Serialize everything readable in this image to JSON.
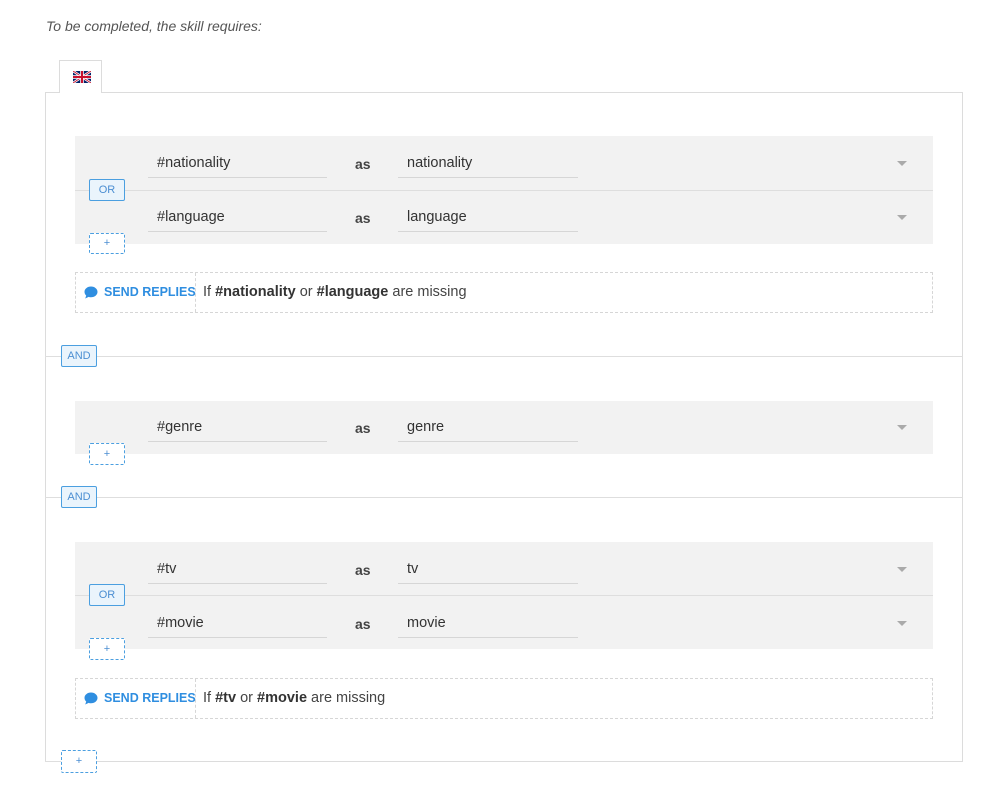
{
  "intro": "To be completed, the skill requires:",
  "language_tab": {
    "flag": "uk-flag-icon"
  },
  "operators": {
    "or": "OR",
    "and": "AND",
    "add": "+",
    "as": "as"
  },
  "groups": [
    {
      "rows": [
        {
          "entity": "#nationality",
          "as": "as",
          "variable": "nationality"
        },
        {
          "entity": "#language",
          "as": "as",
          "variable": "language"
        }
      ],
      "send_replies": {
        "label": "SEND REPLIES",
        "prefix": "If",
        "entities": [
          "#nationality",
          "#language"
        ],
        "joiner": "or",
        "suffix": "are missing"
      }
    },
    {
      "rows": [
        {
          "entity": "#genre",
          "as": "as",
          "variable": "genre"
        }
      ]
    },
    {
      "rows": [
        {
          "entity": "#tv",
          "as": "as",
          "variable": "tv"
        },
        {
          "entity": "#movie",
          "as": "as",
          "variable": "movie"
        }
      ],
      "send_replies": {
        "label": "SEND REPLIES",
        "prefix": "If",
        "entities": [
          "#tv",
          "#movie"
        ],
        "joiner": "or",
        "suffix": "are missing"
      }
    }
  ],
  "colors": {
    "accent": "#2f8ee0",
    "group_bg": "#f2f2f2",
    "border": "#dcdcdc"
  }
}
